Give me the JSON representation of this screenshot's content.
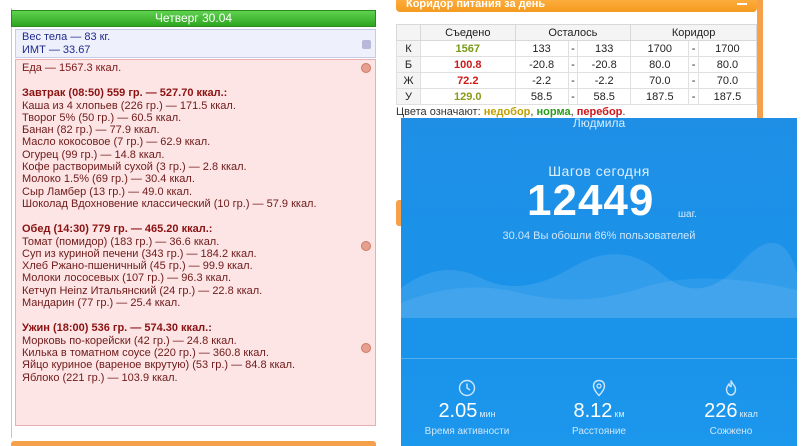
{
  "diary": {
    "header": "Четверг 30.04",
    "weight": "Вес тела — 83 кг.",
    "bmi": "ИМТ — 33.67",
    "food_total": "Еда — 1567.3 ккал.",
    "meals": [
      {
        "title": "Завтрак (08:50) 559 гр. — 527.70 ккал.:",
        "items": [
          "Каша из 4 хлопьев (226 гр.) — 171.5 ккал.",
          "Творог 5% (50 гр.) — 60.5 ккал.",
          "Банан (82 гр.) — 77.9 ккал.",
          "Масло кокосовое (7 гр.) — 62.9 ккал.",
          "Огурец (99 гр.) — 14.8 ккал.",
          "Кофе растворимый сухой (3 гр.) — 2.8 ккал.",
          "Молоко 1.5% (69 гр.) — 30.4 ккал.",
          "Сыр Ламбер (13 гр.) — 49.0 ккал.",
          "Шоколад Вдохновение классический (10 гр.) — 57.9 ккал."
        ]
      },
      {
        "title": "Обед (14:30) 779 гр. — 465.20 ккал.:",
        "items": [
          "Томат (помидор) (183 гр.) — 36.6 ккал.",
          "Суп из куриной печени (343 гр.) — 184.2 ккал.",
          "Хлеб Ржано-пшеничный (45 гр.) — 99.9 ккал.",
          "Молоки лососевых (107 гр.) — 96.3 ккал.",
          "Кетчуп Heinz Итальянский (24 гр.) — 22.8 ккал.",
          "Мандарин (77 гр.) — 25.4 ккал."
        ]
      },
      {
        "title": "Ужин (18:00) 536 гр. — 574.30 ккал.:",
        "items": [
          "Морковь по-корейски (42 гр.) — 24.8 ккал.",
          "Килька в томатном соусе (220 гр.) — 360.8 ккал.",
          "Яйцо куриное (вареное вкрутую) (53 гр.) — 84.8 ккал.",
          "Яблоко (221 гр.) — 103.9 ккал."
        ]
      }
    ]
  },
  "corridor": {
    "title": "Коридор питания за день",
    "headers": [
      "",
      "Съедено",
      "Осталось",
      "Коридор"
    ],
    "rows": [
      {
        "label": "К",
        "eaten": "1567",
        "left_a": "133",
        "dash1": "-",
        "left_b": "133",
        "corr_a": "1700",
        "dash2": "-",
        "corr_b": "1700",
        "color": "#7a9a1a"
      },
      {
        "label": "Б",
        "eaten": "100.8",
        "left_a": "-20.8",
        "dash1": "-",
        "left_b": "-20.8",
        "corr_a": "80.0",
        "dash2": "-",
        "corr_b": "80.0",
        "color": "#cc1a1a"
      },
      {
        "label": "Ж",
        "eaten": "72.2",
        "left_a": "-2.2",
        "dash1": "-",
        "left_b": "-2.2",
        "corr_a": "70.0",
        "dash2": "-",
        "corr_b": "70.0",
        "color": "#cc1a1a"
      },
      {
        "label": "У",
        "eaten": "129.0",
        "left_a": "58.5",
        "dash1": "-",
        "left_b": "58.5",
        "corr_a": "187.5",
        "dash2": "-",
        "corr_b": "187.5",
        "color": "#8a9a1a"
      }
    ],
    "legend_prefix": "Цвета означают: ",
    "legend_under": "недобор",
    "legend_sep1": ", ",
    "legend_norm": "норма",
    "legend_sep2": ", ",
    "legend_over": "перебор",
    "legend_end": "."
  },
  "phone": {
    "user_name": "Людмила",
    "steps_label": "Шагов сегодня",
    "steps_value": "12449",
    "steps_unit": "шаг.",
    "beat_text": "30.04 Вы обошли 86% пользователей",
    "metrics": [
      {
        "icon": "clock-icon",
        "value": "2.05",
        "unit": "мин",
        "label": "Время активности"
      },
      {
        "icon": "location-pin-icon",
        "value": "8.12",
        "unit": "км",
        "label": "Расстояние"
      },
      {
        "icon": "flame-icon",
        "value": "226",
        "unit": "ккал",
        "label": "Сожжено"
      }
    ]
  }
}
